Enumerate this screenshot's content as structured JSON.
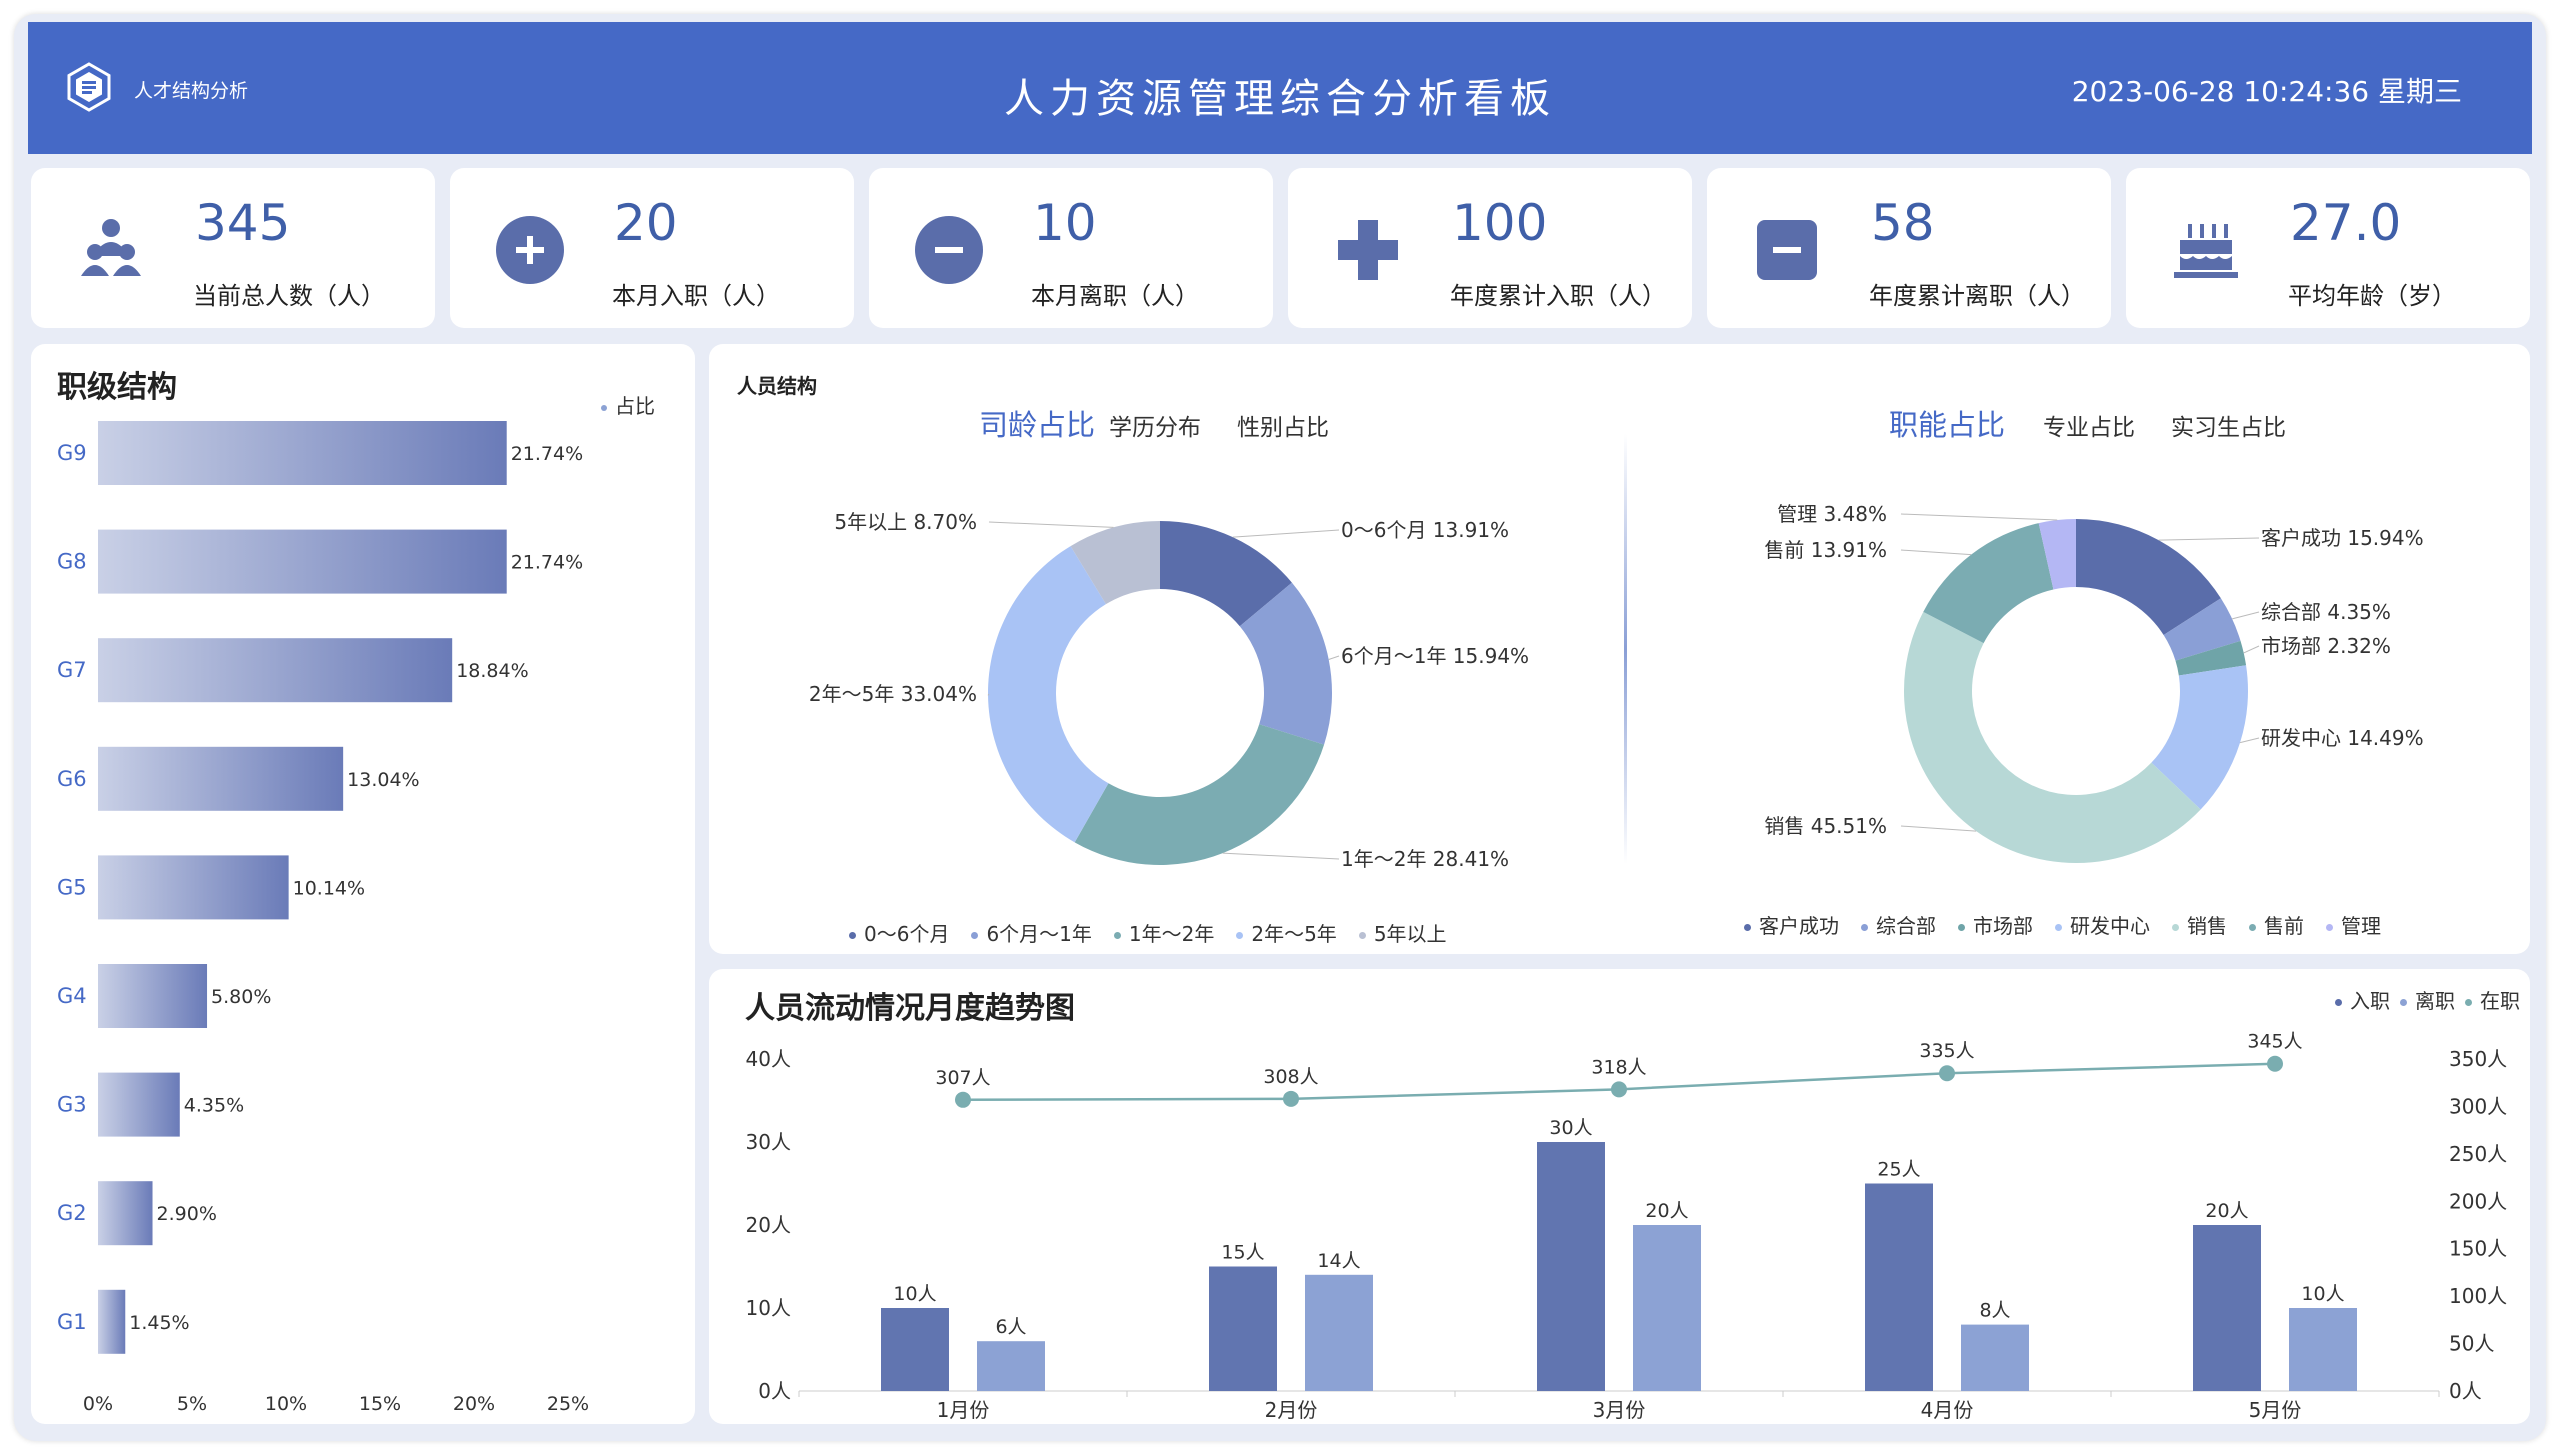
{
  "header": {
    "logo_text": "人才结构分析",
    "title": "人力资源管理综合分析看板",
    "datetime": "2023-06-28 10:24:36 星期三"
  },
  "kpis": [
    {
      "value": "345",
      "label": "当前总人数（人）",
      "icon": "people-icon"
    },
    {
      "value": "20",
      "label": "本月入职（人）",
      "icon": "plus-circle-icon"
    },
    {
      "value": "10",
      "label": "本月离职（人）",
      "icon": "minus-circle-icon"
    },
    {
      "value": "100",
      "label": "年度累计入职（人）",
      "icon": "plus-icon"
    },
    {
      "value": "58",
      "label": "年度累计离职（人）",
      "icon": "minus-square-icon"
    },
    {
      "value": "27.0",
      "label": "平均年龄（岁）",
      "icon": "cake-icon"
    }
  ],
  "grade_panel": {
    "title": "职级结构",
    "legend": "占比"
  },
  "structure_panel": {
    "title": "人员结构",
    "left_tabs": [
      "司龄占比",
      "学历分布",
      "性别占比"
    ],
    "right_tabs": [
      "职能占比",
      "专业占比",
      "实习生占比"
    ]
  },
  "trend_panel": {
    "title": "人员流动情况月度趋势图",
    "legend": [
      "入职",
      "离职",
      "在职"
    ]
  },
  "colors": {
    "header": "#4569c6",
    "bar_dark": "#6175b0",
    "bar_light": "#8ca2d4",
    "line": "#7aadb0",
    "accent": "#3f5fa8"
  },
  "chart_data": [
    {
      "type": "bar",
      "orientation": "horizontal",
      "categories": [
        "G9",
        "G8",
        "G7",
        "G6",
        "G5",
        "G4",
        "G3",
        "G2",
        "G1"
      ],
      "values": [
        21.74,
        21.74,
        18.84,
        13.04,
        10.14,
        5.8,
        4.35,
        2.9,
        1.45
      ],
      "value_labels": [
        "21.74%",
        "21.74%",
        "18.84%",
        "13.04%",
        "10.14%",
        "5.80%",
        "4.35%",
        "2.90%",
        "1.45%"
      ],
      "series_name": "占比",
      "xticks": [
        "0%",
        "5%",
        "10%",
        "15%",
        "20%",
        "25%"
      ],
      "xlim": [
        0,
        25
      ]
    },
    {
      "type": "pie",
      "donut": true,
      "labels": [
        "0～6个月",
        "6个月～1年",
        "1年～2年",
        "2年～5年",
        "5年以上"
      ],
      "values": [
        13.91,
        15.94,
        28.41,
        33.04,
        8.7
      ],
      "slice_labels": [
        "0～6个月 13.91%",
        "6个月～1年 15.94%",
        "1年～2年 28.41%",
        "2年～5年 33.04%",
        "5年以上 8.70%"
      ],
      "colors": [
        "#5a6daa",
        "#8a9fd6",
        "#7bacb2",
        "#a9c3f5",
        "#b9c0d3"
      ]
    },
    {
      "type": "pie",
      "donut": true,
      "labels": [
        "客户成功",
        "综合部",
        "市场部",
        "研发中心",
        "销售",
        "售前",
        "管理"
      ],
      "values": [
        15.94,
        4.35,
        2.32,
        14.49,
        45.51,
        13.91,
        3.48
      ],
      "slice_labels": [
        "客户成功 15.94%",
        "综合部 4.35%",
        "市场部 2.32%",
        "研发中心 14.49%",
        "销售 45.51%",
        "售前 13.91%",
        "管理 3.48%"
      ],
      "colors": [
        "#5a6daa",
        "#8a9fd6",
        "#6fa4a8",
        "#a9c3f5",
        "#b7d8d6",
        "#7bacb2",
        "#b4b7f4"
      ]
    },
    {
      "type": "bar",
      "categories": [
        "1月份",
        "2月份",
        "3月份",
        "4月份",
        "5月份"
      ],
      "series": [
        {
          "name": "入职",
          "values": [
            10,
            15,
            30,
            25,
            20
          ],
          "labels": [
            "10人",
            "15人",
            "30人",
            "25人",
            "20人"
          ]
        },
        {
          "name": "离职",
          "values": [
            6,
            14,
            20,
            8,
            10
          ],
          "labels": [
            "6人",
            "14人",
            "20人",
            "8人",
            "10人"
          ]
        }
      ],
      "line_series": {
        "name": "在职",
        "values": [
          307,
          308,
          318,
          335,
          345
        ],
        "labels": [
          "307人",
          "308人",
          "318人",
          "335人",
          "345人"
        ]
      },
      "yticks_left": [
        "0人",
        "10人",
        "20人",
        "30人",
        "40人"
      ],
      "ylim_left": [
        0,
        40
      ],
      "yticks_right": [
        "0人",
        "50人",
        "100人",
        "150人",
        "200人",
        "250人",
        "300人",
        "350人"
      ],
      "ylim_right": [
        0,
        350
      ]
    }
  ]
}
